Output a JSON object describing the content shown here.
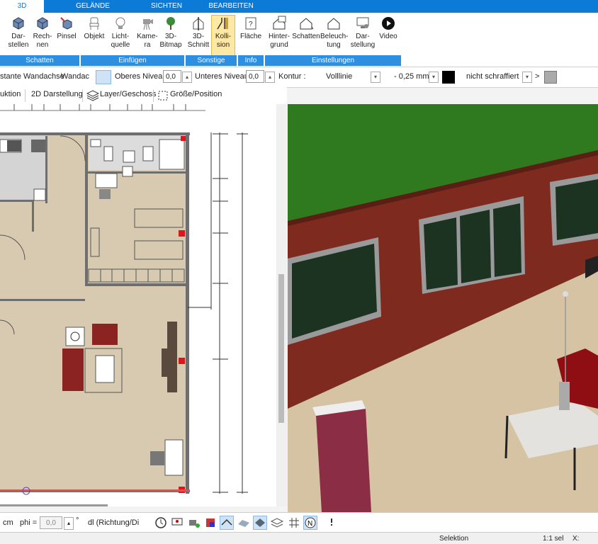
{
  "tabs": [
    {
      "label": "3D"
    },
    {
      "label": "GELÄNDE"
    },
    {
      "label": "SICHTEN"
    },
    {
      "label": "BEARBEITEN"
    }
  ],
  "ribbon": {
    "buttons": [
      {
        "label": "Dar-\nstellen",
        "icon": "cube-render-icon"
      },
      {
        "label": "Rech-\nnen",
        "icon": "cube-calc-icon"
      },
      {
        "label": "Pinsel",
        "icon": "brush-cube-icon"
      },
      {
        "label": "Objekt",
        "icon": "chair-icon"
      },
      {
        "label": "Licht-\nquelle",
        "icon": "bulb-icon"
      },
      {
        "label": "Kame-\nra",
        "icon": "camera-icon"
      },
      {
        "label": "3D-\nBitmap",
        "icon": "tree-icon"
      },
      {
        "label": "3D-\nSchnitt",
        "icon": "section-icon"
      },
      {
        "label": "Kolli-\nsion",
        "icon": "collision-icon"
      },
      {
        "label": "Fläche",
        "icon": "area-icon"
      },
      {
        "label": "Hinter-\ngrund",
        "icon": "house-bg-icon"
      },
      {
        "label": "Schatten",
        "icon": "house-shadow-icon"
      },
      {
        "label": "Beleuch-\ntung",
        "icon": "house-light-icon"
      },
      {
        "label": "Dar-\nstellung",
        "icon": "display-icon"
      },
      {
        "label": "Video",
        "icon": "play-icon"
      }
    ],
    "groups": [
      "Schatten",
      "Einfügen",
      "Sonstige",
      "Info",
      "Einstellungen"
    ]
  },
  "propbar": {
    "wall_axis": "stante Wandachse",
    "wall_select": "Wandac",
    "upper_label": "Oberes Niveau",
    "upper_value": "0,0",
    "lower_label": "Unteres Niveau",
    "lower_value": "0,0",
    "contour_label": "Kontur :",
    "line_style": "Volllinie",
    "line_width": "- 0,25 mm -",
    "hatch": "nicht schraffiert",
    "arrow": ">"
  },
  "subbar": {
    "construction": "uktion",
    "view2d": "2D Darstellung",
    "layer": "Layer/Geschoss",
    "size": "Größe/Position"
  },
  "bottom": {
    "unit": "cm",
    "phi_label": "phi =",
    "phi_value": "0,0",
    "degree": "°",
    "direction": "dl (Richtung/Di"
  },
  "status": {
    "mode": "Selektion",
    "scale": "1:1 sel",
    "x_label": "X:"
  },
  "colors": {
    "ribbon_blue": "#0c7bd8",
    "group_blue": "#2e8fe0",
    "highlight": "#fde8a5",
    "wall_red": "#7f2a1e",
    "sky_green": "#2f7a1e",
    "floor": "#d9c9aa"
  }
}
